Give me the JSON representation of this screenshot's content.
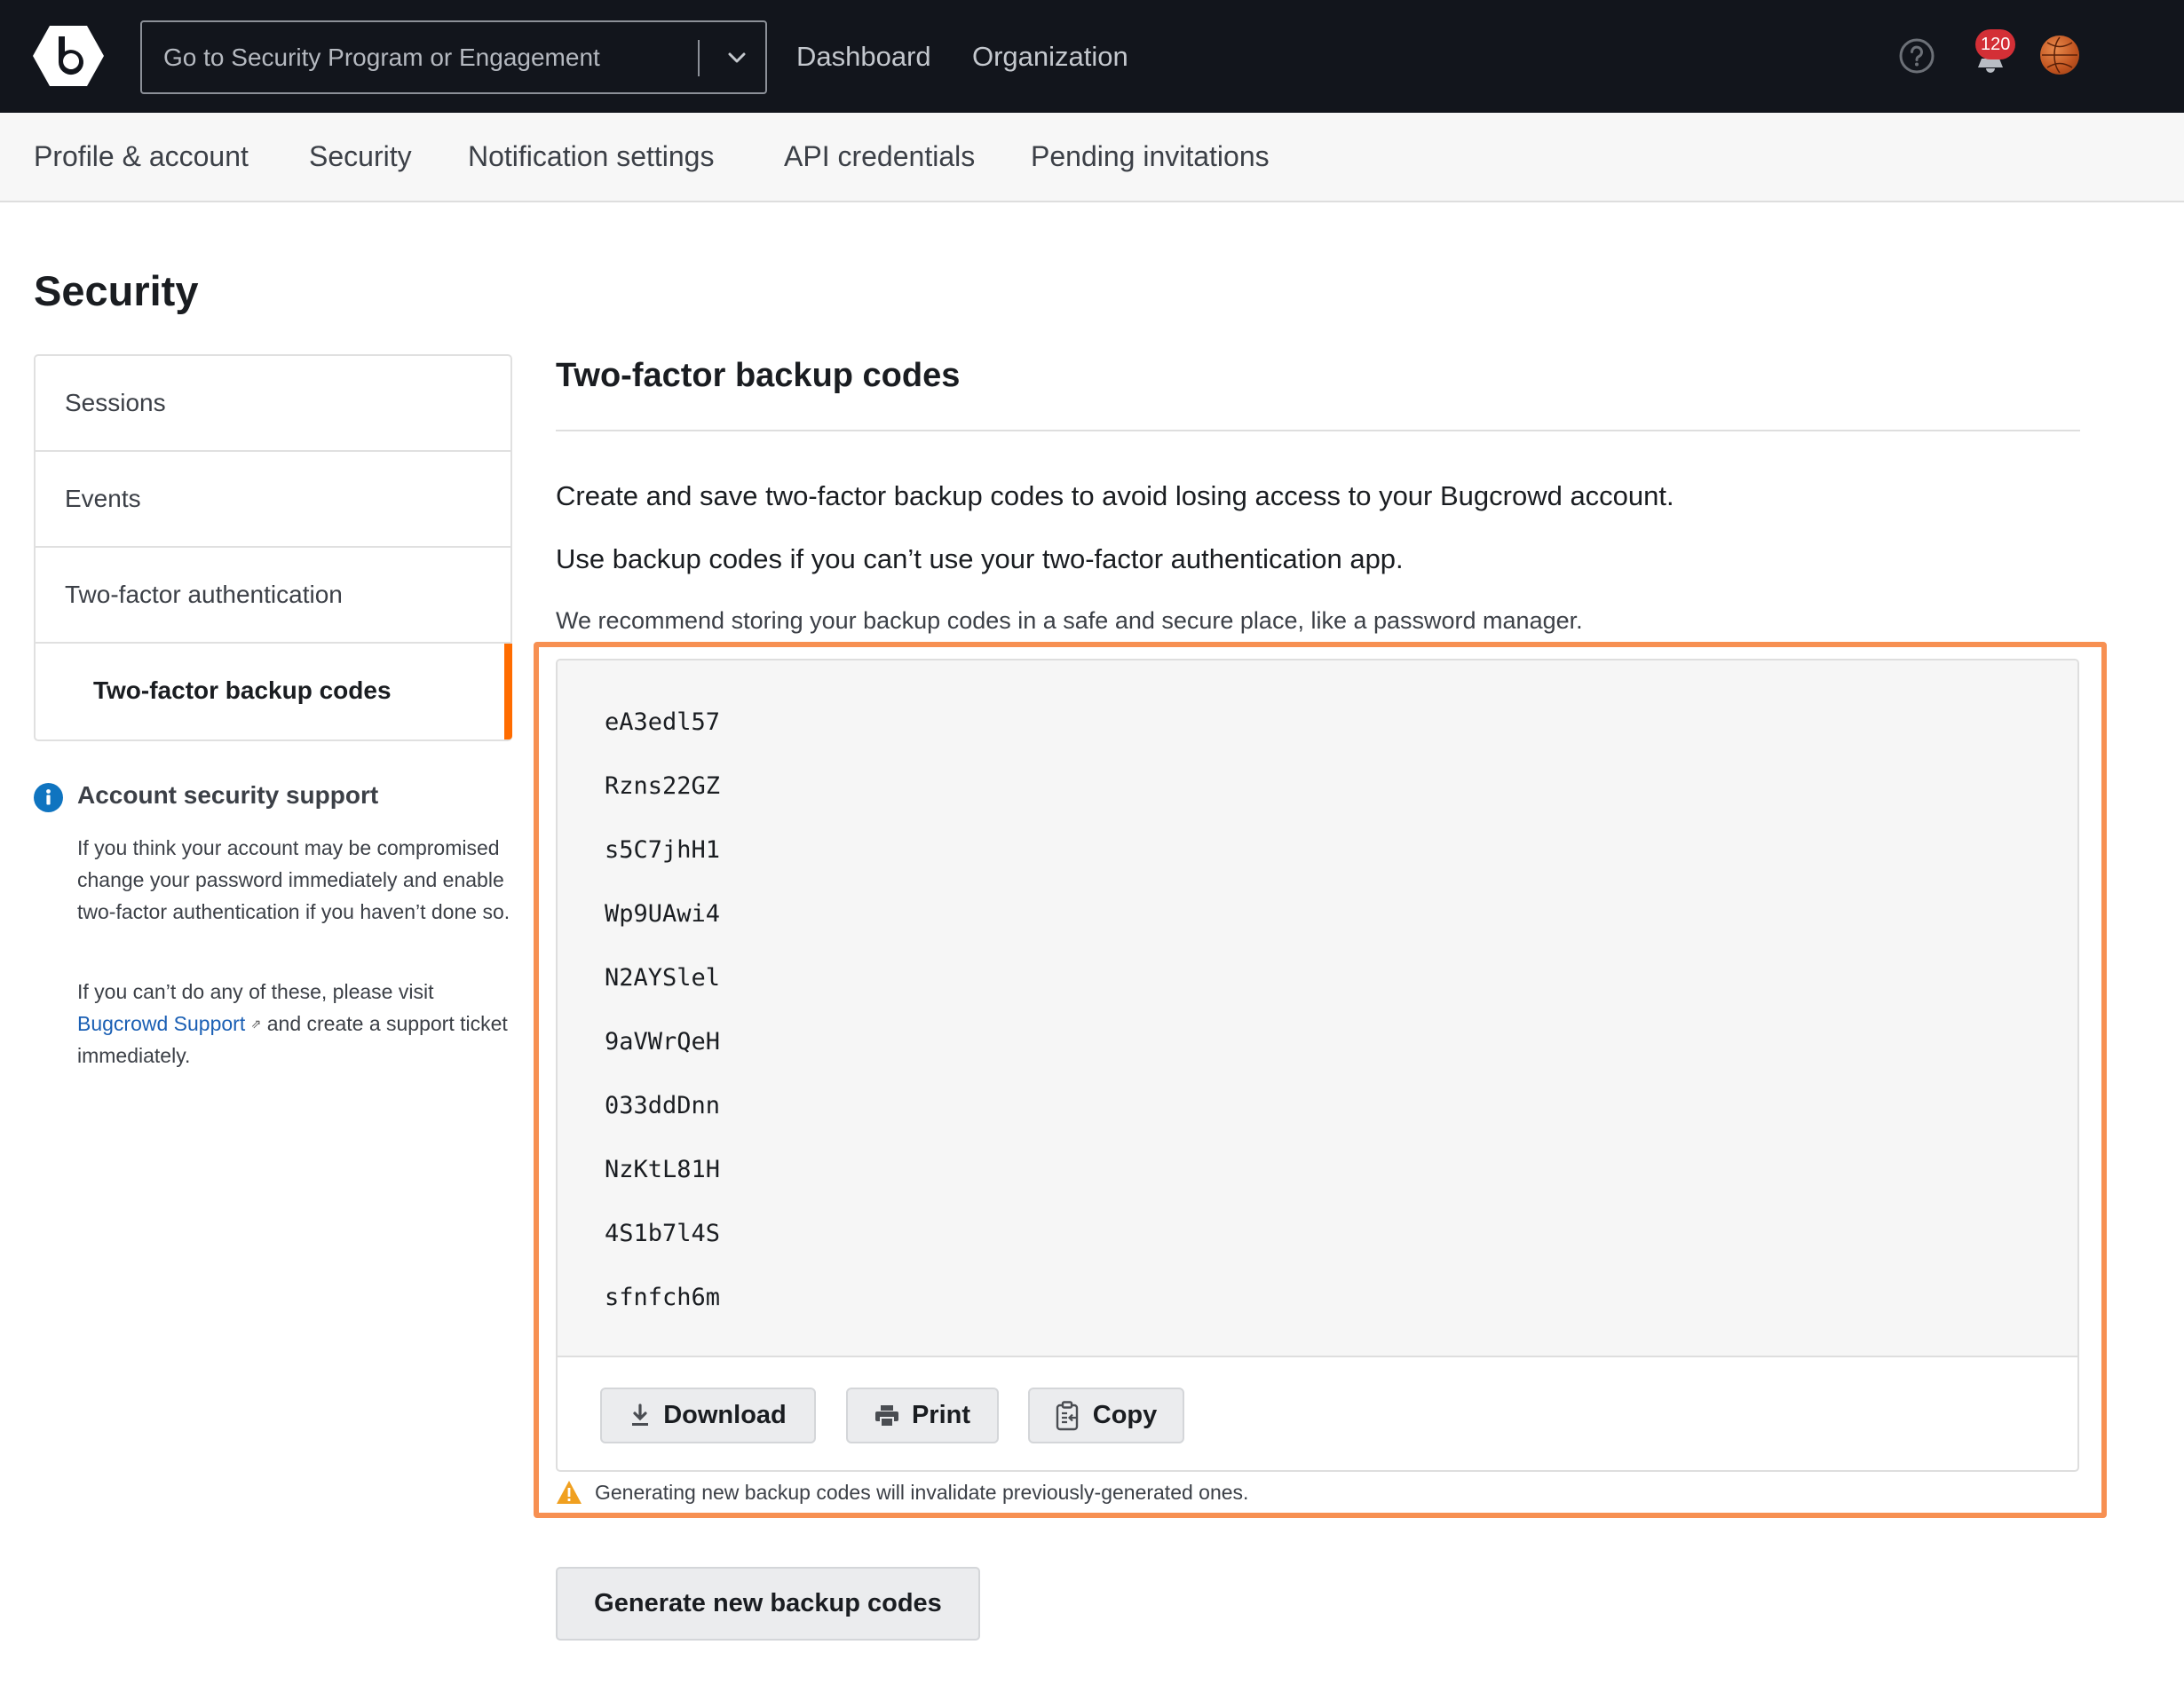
{
  "topbar": {
    "search_placeholder": "Go to Security Program or Engagement",
    "nav": [
      "Dashboard",
      "Organization"
    ],
    "notification_count": "120"
  },
  "tabs": [
    "Profile & account",
    "Security",
    "Notification settings",
    "API credentials",
    "Pending invitations"
  ],
  "page": {
    "title": "Security"
  },
  "sidebar": {
    "items": [
      "Sessions",
      "Events",
      "Two-factor authentication",
      "Two-factor backup codes"
    ],
    "active_item": "Two-factor backup codes"
  },
  "support": {
    "title": "Account security support",
    "paragraph1": "If you think your account may be compromised change your password immediately and enable two-factor authentication if you haven’t done so.",
    "paragraph2_prefix": "If you can’t do any of these, please visit ",
    "link_label": "Bugcrowd Support",
    "paragraph2_suffix": " and create a support ticket immediately."
  },
  "main": {
    "title": "Two-factor backup codes",
    "intro1": "Create and save two-factor backup codes to avoid losing access to your Bugcrowd account.",
    "intro2": "Use backup codes if you can’t use your two-factor authentication app.",
    "recommendation": "We recommend storing your backup codes in a safe and secure place, like a password manager.",
    "codes": [
      "eA3edl57",
      "Rzns22GZ",
      "s5C7jhH1",
      "Wp9UAwi4",
      "N2AYSlel",
      "9aVWrQeH",
      "033ddDnn",
      "NzKtL81H",
      "4S1b7l4S",
      "sfnfch6m"
    ],
    "buttons": {
      "download": "Download",
      "print": "Print",
      "copy": "Copy"
    },
    "warning": "Generating new backup codes will invalidate previously-generated ones.",
    "generate_button": "Generate new backup codes"
  },
  "colors": {
    "topbar_bg": "#12151c",
    "active_accent": "#ff6c00",
    "highlight_border": "#f79052",
    "link": "#1a5fb4",
    "badge": "#d32f36",
    "warning": "#f0a020",
    "info": "#0f74c0"
  }
}
